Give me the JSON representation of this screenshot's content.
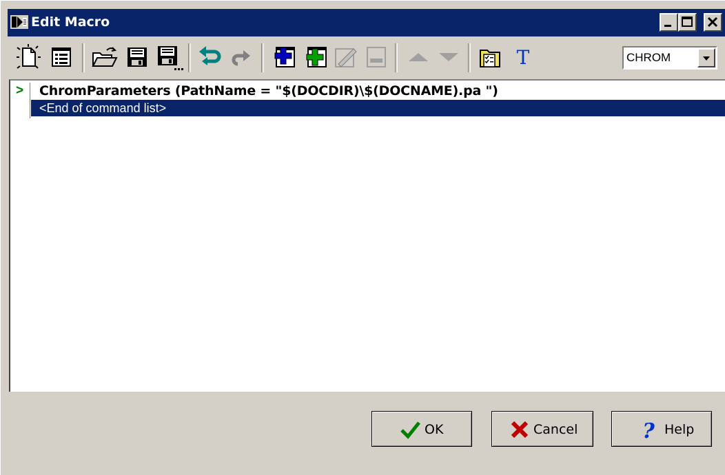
{
  "window": {
    "title": "Edit Macro",
    "colors": {
      "titlebar": "#0a246a",
      "face": "#d4d0c8",
      "selection": "#0a246a"
    }
  },
  "toolbar": {
    "icons": [
      "new-icon",
      "properties-icon",
      "open-icon",
      "save-icon",
      "save-as-icon",
      "undo-icon",
      "redo-icon",
      "insert-command-icon",
      "add-command-icon",
      "edit-command-icon",
      "delete-command-icon",
      "move-up-icon",
      "move-down-icon",
      "folder-checklist-icon",
      "text-icon"
    ],
    "text_button_label": "T",
    "combo_value": "CHROM"
  },
  "command_list": {
    "rows": [
      {
        "marker": ">",
        "text": "ChromParameters (PathName = \"$(DOCDIR)\\$(DOCNAME).pa \")"
      },
      {
        "marker": "",
        "text": "<End of command list>"
      }
    ]
  },
  "buttons": {
    "ok": "OK",
    "cancel": "Cancel",
    "help": "Help"
  }
}
